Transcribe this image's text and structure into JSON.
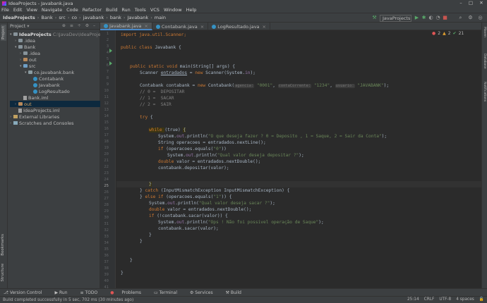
{
  "window": {
    "title": "IdeaProjects - Javabank.java"
  },
  "menu": [
    "File",
    "Edit",
    "View",
    "Navigate",
    "Code",
    "Refactor",
    "Build",
    "Run",
    "Tools",
    "VCS",
    "Window",
    "Help"
  ],
  "breadcrumbs": [
    "IdeaProjects",
    "Bank",
    "src",
    "co",
    "javabank",
    "bank",
    "Javabank",
    "main"
  ],
  "run_config": "JavaProjects",
  "project": {
    "header": "Project",
    "items": [
      {
        "label": "IdeaProjects",
        "extra": "C:\\JavaDev\\IdeaProjects"
      },
      {
        "label": ".idea"
      },
      {
        "label": "Bank"
      },
      {
        "label": ".idea"
      },
      {
        "label": "out"
      },
      {
        "label": "src"
      },
      {
        "label": "co.javabank.bank"
      },
      {
        "label": "Contabank"
      },
      {
        "label": "Javabank"
      },
      {
        "label": "LogResultado"
      },
      {
        "label": "Bank.iml"
      },
      {
        "label": "out"
      },
      {
        "label": "IdeaProjects.iml"
      },
      {
        "label": "External Libraries"
      },
      {
        "label": "Scratches and Consoles"
      }
    ]
  },
  "tabs": [
    "Javabank.java",
    "Contabank.java",
    "LogResultado.java"
  ],
  "left_strip": [
    "Project",
    "Bookmarks",
    "Structure"
  ],
  "right_strip": [
    "Maven",
    "Database",
    "Notifications"
  ],
  "inspections": {
    "errors": "2",
    "warnings": "2",
    "weak": "21"
  },
  "code": {
    "line_numbers": [
      "1",
      "2",
      "3",
      "4",
      "5",
      "6",
      "7",
      "8",
      "9",
      "10",
      "11",
      "12",
      "13",
      "14",
      "15",
      "16",
      "17",
      "18",
      "19",
      "20",
      "21",
      "22",
      "23",
      "24",
      "25",
      "26",
      "27",
      "28",
      "29",
      "30",
      "31",
      "32",
      "33",
      "34",
      "35",
      "36",
      "37",
      "38",
      "39",
      "40",
      "41"
    ],
    "l1": "import java.util.Scanner;",
    "l3a": "public class ",
    "l3b": "Javabank {",
    "l6a": "public static void ",
    "l6b": "main(String[] args) {",
    "l7a": "Scanner ",
    "l7b": "entradados",
    " l7c": "",
    "l7c": " = ",
    "l7d": "new ",
    "l7e": "Scanner(System.",
    "l7f": "in",
    ");": "",
    "l7g": ");",
    "l9a": "Contabank contabank = ",
    "l9b": "new ",
    "l9c": "Contabank(",
    "h1": "agencia:",
    "s1": "\"0001\"",
    "h2": "contaCorrente:",
    "s2": "\"1234\"",
    "h3": "usuario:",
    "s3": "\"JAVABANK\"",
    "l9end": ");",
    "c10": "// 0 =  DEPOSITAR",
    "c11": "// 1 =  SACAR",
    "c12": "// 2 =  SAIR",
    "l14a": "try ",
    "l14b": "{",
    "l16a": "while ",
    "l16b": "(true) ",
    "l16c": "{",
    "l17a": "System.",
    "l17b": "out",
    ".println(": "",
    "l17c": ".println(",
    "s17": "\"O que deseja fazer ? 0 = Deposito , 1 = Saque, 2 = Sair da Conta\"",
    "l17d": ");",
    "l18": "String operacoes = entradados.nextLine();",
    "l19a": "if ",
    "l19b": "(operacoes.equals(",
    "s19": "\"0\"",
    "l19c": "))",
    "l20a": "System.",
    "l20b": "out",
    "l20c": ".println(",
    "s20": "\"Qual valor deseja depositar ?\"",
    "l20d": ");",
    "l21a": "double ",
    "l21b": "valor = entradados.nextDouble();",
    "l22": "contabank.depositar(valor);",
    "l24": "}",
    "l25a": "} ",
    "l25b": "catch ",
    "l25c": "(InputMismatchException InputMismatchException) {",
    "l26a": "} ",
    "l26b": "else if ",
    "l26c": "(operacoes.equals(",
    "s26": "\"1\"",
    "l26d": ")) {",
    "l27a": "System.",
    "l27b": "out",
    "l27c": ".println(",
    "s27": "\"Qual valor deseja sacar ?\"",
    "l27d": ");",
    "l28a": "double ",
    "l28b": "valor = entradados.nextDouble();",
    "l29a": "if ",
    "l29b": "(!contabank.sacar(valor)) {",
    "l30a": "System.",
    "l30b": "out",
    "l30c": ".println(",
    "s30": "\"Ops ! Não foi possivel operação de Saque\"",
    "l30d": ");",
    "l31": "contabank.sacar(valor);",
    "l32": "}",
    "l33": "}",
    "l35": "}",
    "l38": "}"
  },
  "bottom_tools": [
    "Version Control",
    "Run",
    "TODO",
    "Problems",
    "Terminal",
    "Services",
    "Build"
  ],
  "status": {
    "message": "Build completed successfully in 5 sec, 702 ms (30 minutes ago)",
    "position": "25:14",
    "line_sep": "CRLF",
    "encoding": "UTF-8",
    "indent": "4 spaces"
  }
}
